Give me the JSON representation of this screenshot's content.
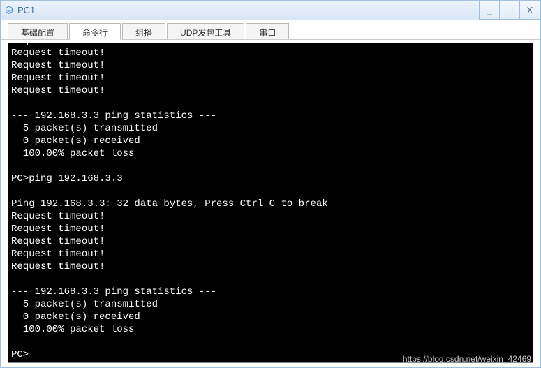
{
  "window": {
    "title": "PC1",
    "controls": {
      "minimize": "_",
      "maximize": "□",
      "close": "X"
    }
  },
  "tabs": [
    {
      "label": "基础配置",
      "active": false
    },
    {
      "label": "命令行",
      "active": true
    },
    {
      "label": "组播",
      "active": false
    },
    {
      "label": "UDP发包工具",
      "active": false
    },
    {
      "label": "串口",
      "active": false
    }
  ],
  "terminal": {
    "lines": [
      "Request timeout!",
      "Request timeout!",
      "Request timeout!",
      "Request timeout!",
      "Request timeout!",
      "",
      "--- 192.168.3.3 ping statistics ---",
      "  5 packet(s) transmitted",
      "  0 packet(s) received",
      "  100.00% packet loss",
      "",
      "PC>ping 192.168.3.3",
      "",
      "Ping 192.168.3.3: 32 data bytes, Press Ctrl_C to break",
      "Request timeout!",
      "Request timeout!",
      "Request timeout!",
      "Request timeout!",
      "Request timeout!",
      "",
      "--- 192.168.3.3 ping statistics ---",
      "  5 packet(s) transmitted",
      "  0 packet(s) received",
      "  100.00% packet loss",
      "",
      "PC>"
    ],
    "prompt_cursor": true
  },
  "watermark": "https://blog.csdn.net/weixin_42469"
}
